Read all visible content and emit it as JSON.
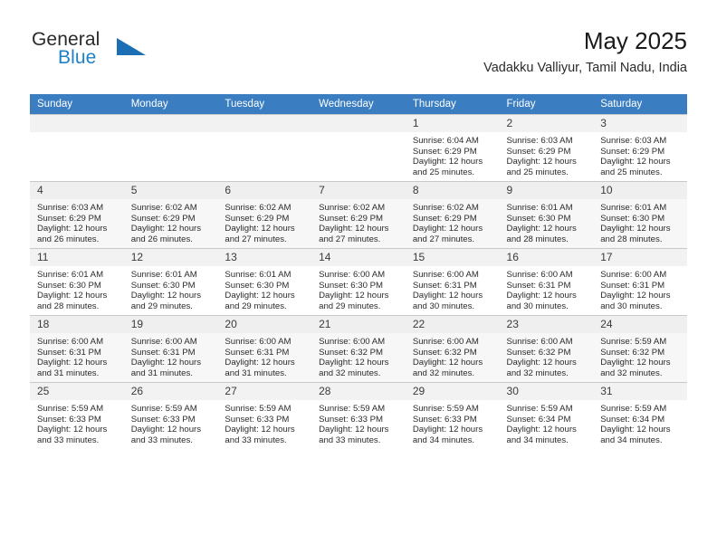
{
  "logo": {
    "word_top": "General",
    "word_bottom": "Blue",
    "triangle_color": "#1c6fb5",
    "blue_color": "#1f7fc4"
  },
  "header": {
    "title": "May 2025",
    "subtitle": "Vadakku Valliyur, Tamil Nadu, India"
  },
  "theme": {
    "header_bg": "#3a7dc0",
    "header_text": "#ffffff",
    "daynum_bg": "#f2f2f2",
    "band_bg": "#f7f7f7",
    "grid_line": "#c8c8c8"
  },
  "calendar": {
    "weekday_headers": [
      "Sunday",
      "Monday",
      "Tuesday",
      "Wednesday",
      "Thursday",
      "Friday",
      "Saturday"
    ],
    "labels": {
      "sunrise": "Sunrise:",
      "sunset": "Sunset:",
      "daylight": "Daylight:"
    },
    "weeks": [
      [
        {
          "day": "",
          "lines": []
        },
        {
          "day": "",
          "lines": []
        },
        {
          "day": "",
          "lines": []
        },
        {
          "day": "",
          "lines": []
        },
        {
          "day": "1",
          "lines": [
            "Sunrise: 6:04 AM",
            "Sunset: 6:29 PM",
            "Daylight: 12 hours",
            "and 25 minutes."
          ]
        },
        {
          "day": "2",
          "lines": [
            "Sunrise: 6:03 AM",
            "Sunset: 6:29 PM",
            "Daylight: 12 hours",
            "and 25 minutes."
          ]
        },
        {
          "day": "3",
          "lines": [
            "Sunrise: 6:03 AM",
            "Sunset: 6:29 PM",
            "Daylight: 12 hours",
            "and 25 minutes."
          ]
        }
      ],
      [
        {
          "day": "4",
          "lines": [
            "Sunrise: 6:03 AM",
            "Sunset: 6:29 PM",
            "Daylight: 12 hours",
            "and 26 minutes."
          ]
        },
        {
          "day": "5",
          "lines": [
            "Sunrise: 6:02 AM",
            "Sunset: 6:29 PM",
            "Daylight: 12 hours",
            "and 26 minutes."
          ]
        },
        {
          "day": "6",
          "lines": [
            "Sunrise: 6:02 AM",
            "Sunset: 6:29 PM",
            "Daylight: 12 hours",
            "and 27 minutes."
          ]
        },
        {
          "day": "7",
          "lines": [
            "Sunrise: 6:02 AM",
            "Sunset: 6:29 PM",
            "Daylight: 12 hours",
            "and 27 minutes."
          ]
        },
        {
          "day": "8",
          "lines": [
            "Sunrise: 6:02 AM",
            "Sunset: 6:29 PM",
            "Daylight: 12 hours",
            "and 27 minutes."
          ]
        },
        {
          "day": "9",
          "lines": [
            "Sunrise: 6:01 AM",
            "Sunset: 6:30 PM",
            "Daylight: 12 hours",
            "and 28 minutes."
          ]
        },
        {
          "day": "10",
          "lines": [
            "Sunrise: 6:01 AM",
            "Sunset: 6:30 PM",
            "Daylight: 12 hours",
            "and 28 minutes."
          ]
        }
      ],
      [
        {
          "day": "11",
          "lines": [
            "Sunrise: 6:01 AM",
            "Sunset: 6:30 PM",
            "Daylight: 12 hours",
            "and 28 minutes."
          ]
        },
        {
          "day": "12",
          "lines": [
            "Sunrise: 6:01 AM",
            "Sunset: 6:30 PM",
            "Daylight: 12 hours",
            "and 29 minutes."
          ]
        },
        {
          "day": "13",
          "lines": [
            "Sunrise: 6:01 AM",
            "Sunset: 6:30 PM",
            "Daylight: 12 hours",
            "and 29 minutes."
          ]
        },
        {
          "day": "14",
          "lines": [
            "Sunrise: 6:00 AM",
            "Sunset: 6:30 PM",
            "Daylight: 12 hours",
            "and 29 minutes."
          ]
        },
        {
          "day": "15",
          "lines": [
            "Sunrise: 6:00 AM",
            "Sunset: 6:31 PM",
            "Daylight: 12 hours",
            "and 30 minutes."
          ]
        },
        {
          "day": "16",
          "lines": [
            "Sunrise: 6:00 AM",
            "Sunset: 6:31 PM",
            "Daylight: 12 hours",
            "and 30 minutes."
          ]
        },
        {
          "day": "17",
          "lines": [
            "Sunrise: 6:00 AM",
            "Sunset: 6:31 PM",
            "Daylight: 12 hours",
            "and 30 minutes."
          ]
        }
      ],
      [
        {
          "day": "18",
          "lines": [
            "Sunrise: 6:00 AM",
            "Sunset: 6:31 PM",
            "Daylight: 12 hours",
            "and 31 minutes."
          ]
        },
        {
          "day": "19",
          "lines": [
            "Sunrise: 6:00 AM",
            "Sunset: 6:31 PM",
            "Daylight: 12 hours",
            "and 31 minutes."
          ]
        },
        {
          "day": "20",
          "lines": [
            "Sunrise: 6:00 AM",
            "Sunset: 6:31 PM",
            "Daylight: 12 hours",
            "and 31 minutes."
          ]
        },
        {
          "day": "21",
          "lines": [
            "Sunrise: 6:00 AM",
            "Sunset: 6:32 PM",
            "Daylight: 12 hours",
            "and 32 minutes."
          ]
        },
        {
          "day": "22",
          "lines": [
            "Sunrise: 6:00 AM",
            "Sunset: 6:32 PM",
            "Daylight: 12 hours",
            "and 32 minutes."
          ]
        },
        {
          "day": "23",
          "lines": [
            "Sunrise: 6:00 AM",
            "Sunset: 6:32 PM",
            "Daylight: 12 hours",
            "and 32 minutes."
          ]
        },
        {
          "day": "24",
          "lines": [
            "Sunrise: 5:59 AM",
            "Sunset: 6:32 PM",
            "Daylight: 12 hours",
            "and 32 minutes."
          ]
        }
      ],
      [
        {
          "day": "25",
          "lines": [
            "Sunrise: 5:59 AM",
            "Sunset: 6:33 PM",
            "Daylight: 12 hours",
            "and 33 minutes."
          ]
        },
        {
          "day": "26",
          "lines": [
            "Sunrise: 5:59 AM",
            "Sunset: 6:33 PM",
            "Daylight: 12 hours",
            "and 33 minutes."
          ]
        },
        {
          "day": "27",
          "lines": [
            "Sunrise: 5:59 AM",
            "Sunset: 6:33 PM",
            "Daylight: 12 hours",
            "and 33 minutes."
          ]
        },
        {
          "day": "28",
          "lines": [
            "Sunrise: 5:59 AM",
            "Sunset: 6:33 PM",
            "Daylight: 12 hours",
            "and 33 minutes."
          ]
        },
        {
          "day": "29",
          "lines": [
            "Sunrise: 5:59 AM",
            "Sunset: 6:33 PM",
            "Daylight: 12 hours",
            "and 34 minutes."
          ]
        },
        {
          "day": "30",
          "lines": [
            "Sunrise: 5:59 AM",
            "Sunset: 6:34 PM",
            "Daylight: 12 hours",
            "and 34 minutes."
          ]
        },
        {
          "day": "31",
          "lines": [
            "Sunrise: 5:59 AM",
            "Sunset: 6:34 PM",
            "Daylight: 12 hours",
            "and 34 minutes."
          ]
        }
      ]
    ]
  }
}
